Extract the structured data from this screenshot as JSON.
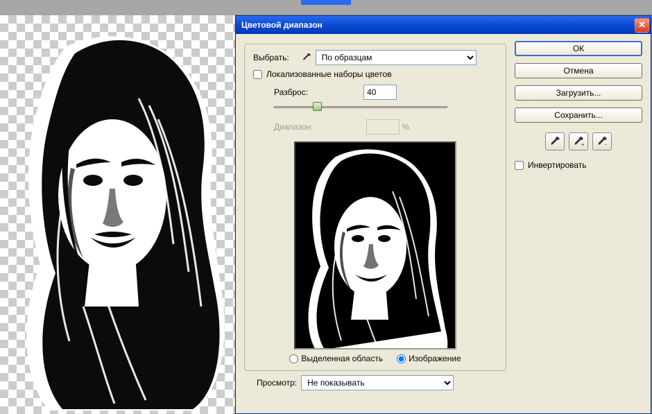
{
  "dialog": {
    "title": "Цветовой диапазон",
    "select_label": "Выбрать:",
    "select_value": "По образцам",
    "localized_label": "Локализованные наборы цветов",
    "fuzziness_label": "Разброс:",
    "fuzziness_value": "40",
    "range_label": "Диапазон:",
    "range_unit": "%",
    "radio_selection": "Выделенная область",
    "radio_image": "Изображение",
    "preview_label": "Просмотр:",
    "preview_value": "Не показывать"
  },
  "buttons": {
    "ok": "ОК",
    "cancel": "Отмена",
    "load": "Загрузить...",
    "save": "Сохранить..."
  },
  "invert_label": "Инвертировать",
  "icons": {
    "eyedropper": "eyedropper",
    "eyedropper_plus": "eyedropper-plus",
    "eyedropper_minus": "eyedropper-minus",
    "close": "close"
  }
}
